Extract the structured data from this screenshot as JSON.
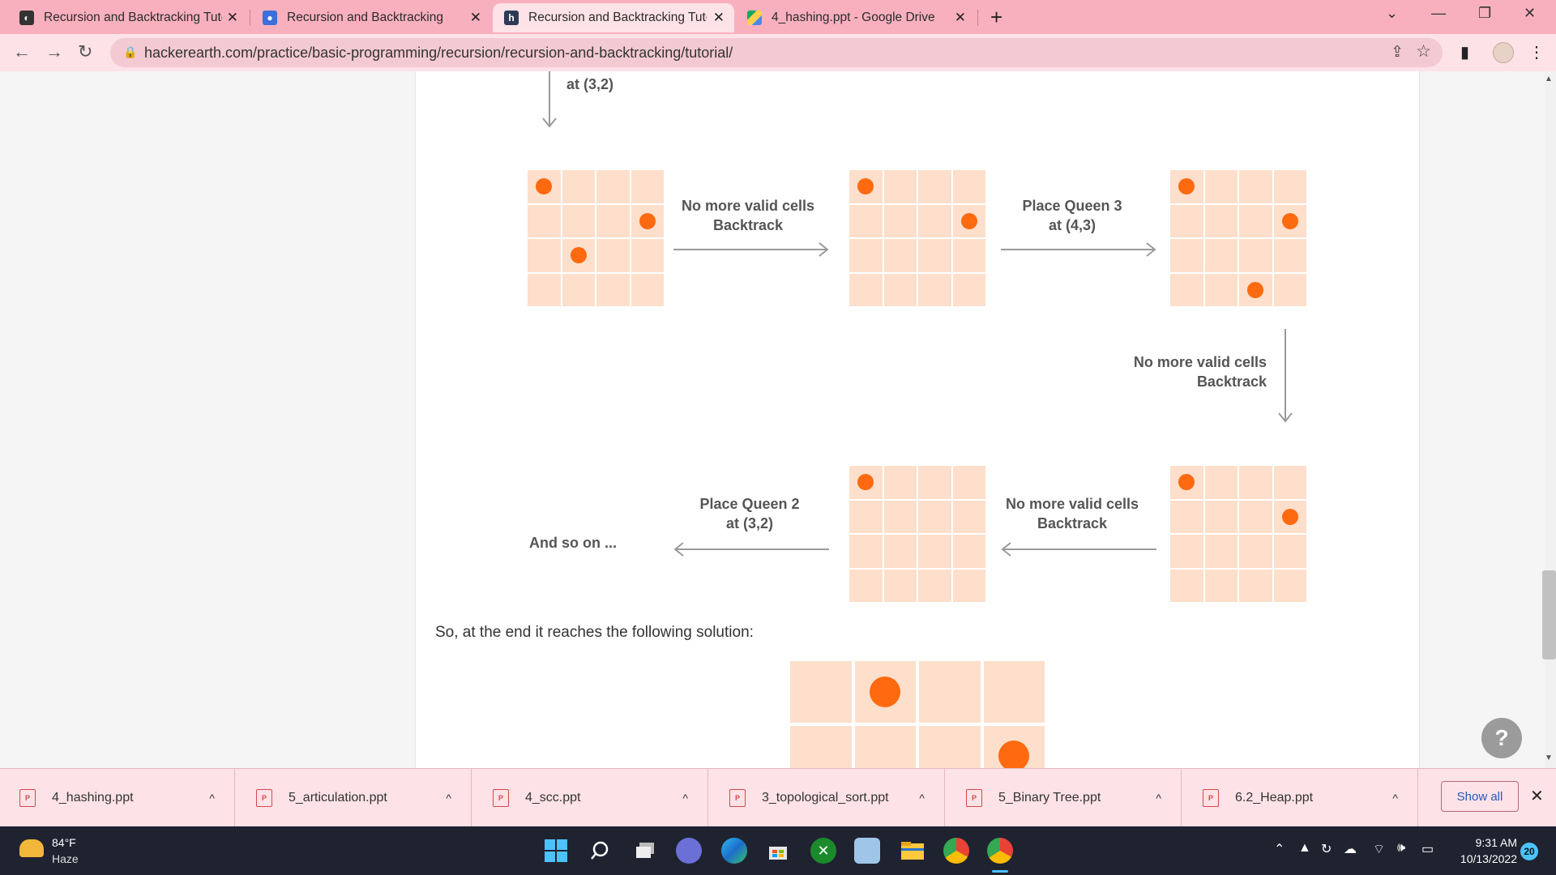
{
  "tabs": [
    {
      "title": "Recursion and Backtracking Tuto",
      "close": "✕"
    },
    {
      "title": "Recursion and Backtracking",
      "close": "✕"
    },
    {
      "title": "Recursion and Backtracking Tuto",
      "close": "✕"
    },
    {
      "title": "4_hashing.ppt - Google Drive",
      "close": "✕"
    }
  ],
  "new_tab": "+",
  "window_controls": {
    "dropdown": "⌄",
    "minimize": "—",
    "restore": "❐",
    "close": "✕"
  },
  "toolbar": {
    "back": "←",
    "forward": "→",
    "reload": "↻",
    "url": "hackerearth.com/practice/basic-programming/recursion/recursion-and-backtracking/tutorial/",
    "share": "⇪",
    "bookmark": "☆",
    "sidebar": "▮",
    "menu": "⋮"
  },
  "diagram": {
    "top_label": "at (3,2)",
    "edge1": {
      "line1": "No more valid cells",
      "line2": "Backtrack"
    },
    "edge2": {
      "line1": "Place Queen 3",
      "line2": "at (4,3)"
    },
    "edge3": {
      "line1": "No more valid cells",
      "line2": "Backtrack"
    },
    "edge4": {
      "line1": "No more valid cells",
      "line2": "Backtrack"
    },
    "edge5": {
      "line1": "Place Queen 2",
      "line2": "at (3,2)"
    },
    "and_so_on": "And so on ...",
    "boards": [
      {
        "queens": [
          [
            0,
            0
          ],
          [
            1,
            3
          ],
          [
            2,
            1
          ]
        ]
      },
      {
        "queens": [
          [
            0,
            0
          ],
          [
            1,
            3
          ]
        ]
      },
      {
        "queens": [
          [
            0,
            0
          ],
          [
            1,
            3
          ],
          [
            3,
            2
          ]
        ]
      },
      {
        "queens": [
          [
            0,
            0
          ],
          [
            1,
            3
          ]
        ]
      },
      {
        "queens": [
          [
            0,
            0
          ]
        ]
      }
    ],
    "solution_board": {
      "queens": [
        [
          0,
          1
        ],
        [
          1,
          3
        ]
      ]
    }
  },
  "paragraph": "So, at the end it reaches the following solution:",
  "help_button": "?",
  "downloads": [
    {
      "name": "4_hashing.ppt"
    },
    {
      "name": "5_articulation.ppt"
    },
    {
      "name": "4_scc.ppt"
    },
    {
      "name": "3_topological_sort.ppt"
    },
    {
      "name": "5_Binary Tree.ppt"
    },
    {
      "name": "6.2_Heap.ppt"
    }
  ],
  "download_chevron": "^",
  "file_icon_label": "P",
  "show_all": "Show all",
  "shelf_close": "✕",
  "weather": {
    "temp": "84°F",
    "condition": "Haze"
  },
  "clock": {
    "time": "9:31 AM",
    "date": "10/13/2022"
  },
  "notifications": "20",
  "colors": {
    "tab_bar": "#f9b0be",
    "toolbar": "#fde2e7",
    "cell": "#fddfcb",
    "queen": "#ff6a10",
    "taskbar": "#1f2330"
  }
}
